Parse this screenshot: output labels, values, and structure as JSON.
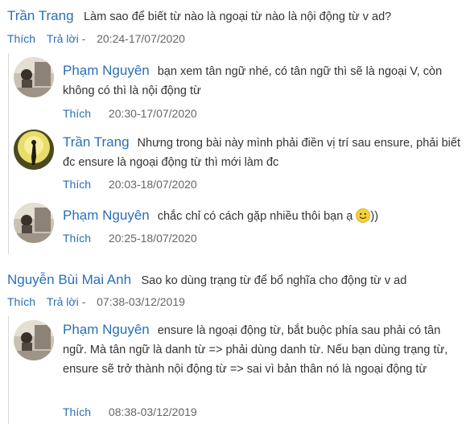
{
  "thread1": {
    "author": "Trần Trang",
    "text": "Làm sao để biết từ nào là ngoại từ nào là nội động từ v ad?",
    "like_label": "Thích",
    "reply_label": "Trả lời",
    "separator": "-",
    "time": "20:24-17/07/2020",
    "replies": [
      {
        "author": "Phạm Nguyên",
        "text": "bạn xem tân ngữ nhé, có tân ngữ thì sẽ là ngoại V, còn không có thì là nội động từ",
        "like_label": "Thích",
        "time": "20:30-17/07/2020"
      },
      {
        "author": "Trần Trang",
        "text": "Nhưng trong bài này mình phải điền vị trí sau ensure, phải biết đc ensure là ngoại động từ thì mới làm đc",
        "like_label": "Thích",
        "time": "20:03-18/07/2020"
      },
      {
        "author": "Phạm Nguyên",
        "text": "chắc chỉ có cách gặp nhiều thôi bạn ạ",
        "text_after": "))",
        "like_label": "Thích",
        "time": "20:25-18/07/2020"
      }
    ]
  },
  "thread2": {
    "author": "Nguyễn Bùi Mai Anh",
    "text": "Sao ko dùng trạng từ để bổ nghĩa cho động từ v ad",
    "like_label": "Thích",
    "reply_label": "Trả lời",
    "separator": "-",
    "time": "07:38-03/12/2019",
    "replies": [
      {
        "author": "Phạm Nguyên",
        "text": "ensure là ngoại động từ, bắt buộc phía sau phải có tân ngữ. Mà tân ngữ là danh từ => phải dùng danh từ. Nếu bạn dùng trạng từ, ensure sẽ trở thành nội động từ => sai vì bản thân nó là ngoại động từ",
        "like_label": "Thích",
        "time": "08:38-03/12/2019"
      }
    ]
  }
}
